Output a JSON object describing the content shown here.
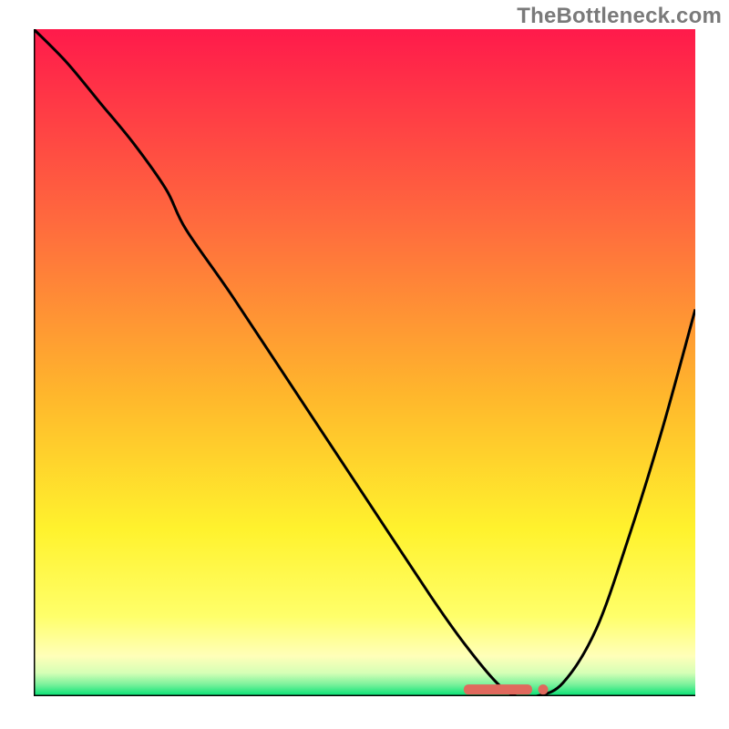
{
  "branding": {
    "watermark": "TheBottleneck.com"
  },
  "chart_data": {
    "type": "line",
    "title": "",
    "xlabel": "",
    "ylabel": "",
    "xlim": [
      0,
      100
    ],
    "ylim": [
      0,
      100
    ],
    "grid": false,
    "legend": false,
    "background_gradient": {
      "stops": [
        {
          "pos": 0.0,
          "color": "#ff1a4b"
        },
        {
          "pos": 0.3,
          "color": "#ff6d3d"
        },
        {
          "pos": 0.55,
          "color": "#ffb72c"
        },
        {
          "pos": 0.75,
          "color": "#fff22d"
        },
        {
          "pos": 0.88,
          "color": "#ffff6a"
        },
        {
          "pos": 0.94,
          "color": "#ffffb9"
        },
        {
          "pos": 0.965,
          "color": "#d6ffb6"
        },
        {
          "pos": 0.982,
          "color": "#7df29c"
        },
        {
          "pos": 1.0,
          "color": "#00e173"
        }
      ]
    },
    "series": [
      {
        "name": "bottleneck-curve",
        "color": "#000000",
        "x": [
          0,
          5,
          10,
          15,
          20,
          23,
          30,
          40,
          50,
          60,
          65,
          70,
          73,
          76,
          80,
          85,
          90,
          95,
          100
        ],
        "y": [
          100,
          95,
          89,
          83,
          76,
          70,
          60,
          45,
          30,
          15,
          8,
          2,
          0,
          0,
          2,
          10,
          24,
          40,
          58
        ]
      }
    ],
    "markers": {
      "name": "optimal-range",
      "color": "#e0695d",
      "shape": "rounded-bar",
      "x_start": 65,
      "x_end": 77,
      "y": 1
    }
  }
}
